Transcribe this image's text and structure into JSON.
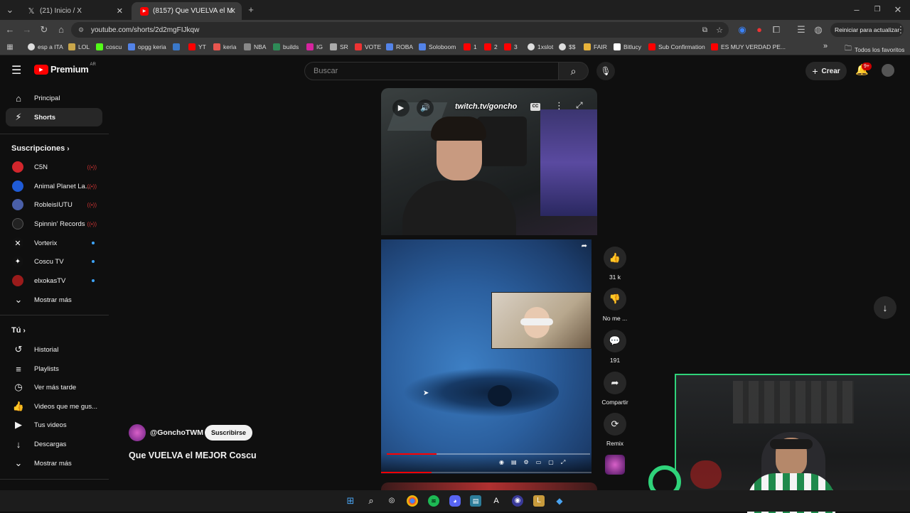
{
  "browser": {
    "tabs": [
      {
        "title": "(21) Inicio / X",
        "active": false
      },
      {
        "title": "(8157) Que VUELVA el MEJOR C",
        "active": true
      }
    ],
    "url": "youtube.com/shorts/2d2mgFIJkqw",
    "update_label": "Reiniciar para actualizar",
    "bookmarks": [
      "esp a ITA",
      "LOL",
      "coscu",
      "opgg keria",
      "",
      "YT",
      "keria",
      "NBA",
      "builds",
      "IG",
      "SR",
      "VOTE",
      "ROBA",
      "Soloboom",
      "1",
      "2",
      "3",
      "1xslot",
      "$$",
      "FAIR",
      "Bitlucy",
      "Sub Confirmation",
      "ES MUY VERDAD PE..."
    ],
    "bookmarks_more": "»",
    "all_bookmarks": "Todos los favoritos"
  },
  "youtube": {
    "logo": "Premium",
    "country": "AR",
    "search_placeholder": "Buscar",
    "create_label": "Crear",
    "notifications": "9+",
    "sidebar": {
      "main": [
        {
          "label": "Principal",
          "icon": "home-icon"
        },
        {
          "label": "Shorts",
          "icon": "shorts-icon",
          "active": true
        }
      ],
      "subs_title": "Suscripciones",
      "subs": [
        {
          "label": "C5N",
          "badge": "live",
          "color": "#d2262c",
          "abbr": "C5N"
        },
        {
          "label": "Animal Planet La...",
          "badge": "live",
          "color": "#1f5bd6",
          "abbr": "AP"
        },
        {
          "label": "RobleisIUTU",
          "badge": "live",
          "color": "#4a5fa8",
          "abbr": "R"
        },
        {
          "label": "Spinnin' Records",
          "badge": "live",
          "color": "#111111",
          "abbr": "S"
        },
        {
          "label": "Vorterix",
          "badge": "dot",
          "color": "#111111",
          "abbr": "✕"
        },
        {
          "label": "Coscu TV",
          "badge": "dot",
          "color": "#111111",
          "abbr": "✦"
        },
        {
          "label": "elxokasTV",
          "badge": "dot",
          "color": "#9b1b1b",
          "abbr": "X"
        }
      ],
      "subs_more": "Mostrar más",
      "you_title": "Tú",
      "you": [
        {
          "label": "Historial",
          "icon": "history-icon"
        },
        {
          "label": "Playlists",
          "icon": "playlists-icon"
        },
        {
          "label": "Ver más tarde",
          "icon": "watch-later-icon"
        },
        {
          "label": "Videos que me gus...",
          "icon": "liked-icon"
        },
        {
          "label": "Tus videos",
          "icon": "your-videos-icon"
        },
        {
          "label": "Descargas",
          "icon": "downloads-icon"
        }
      ],
      "you_more": "Mostrar más"
    },
    "short": {
      "overlay_text": "twitch.tv/goncho",
      "channel": "@GonchoTWM",
      "subscribe_label": "Suscribirse",
      "title": "Que VUELVA el MEJOR Coscu",
      "progress": 0.24,
      "likes": "31 k",
      "dislike_label": "No me ...",
      "comments": "191",
      "share_label": "Compartir",
      "remix_label": "Remix"
    }
  },
  "colors": {
    "background": "#0f0f0f",
    "youtube_red": "#ff0000",
    "cam_border": "#2fd37a"
  }
}
